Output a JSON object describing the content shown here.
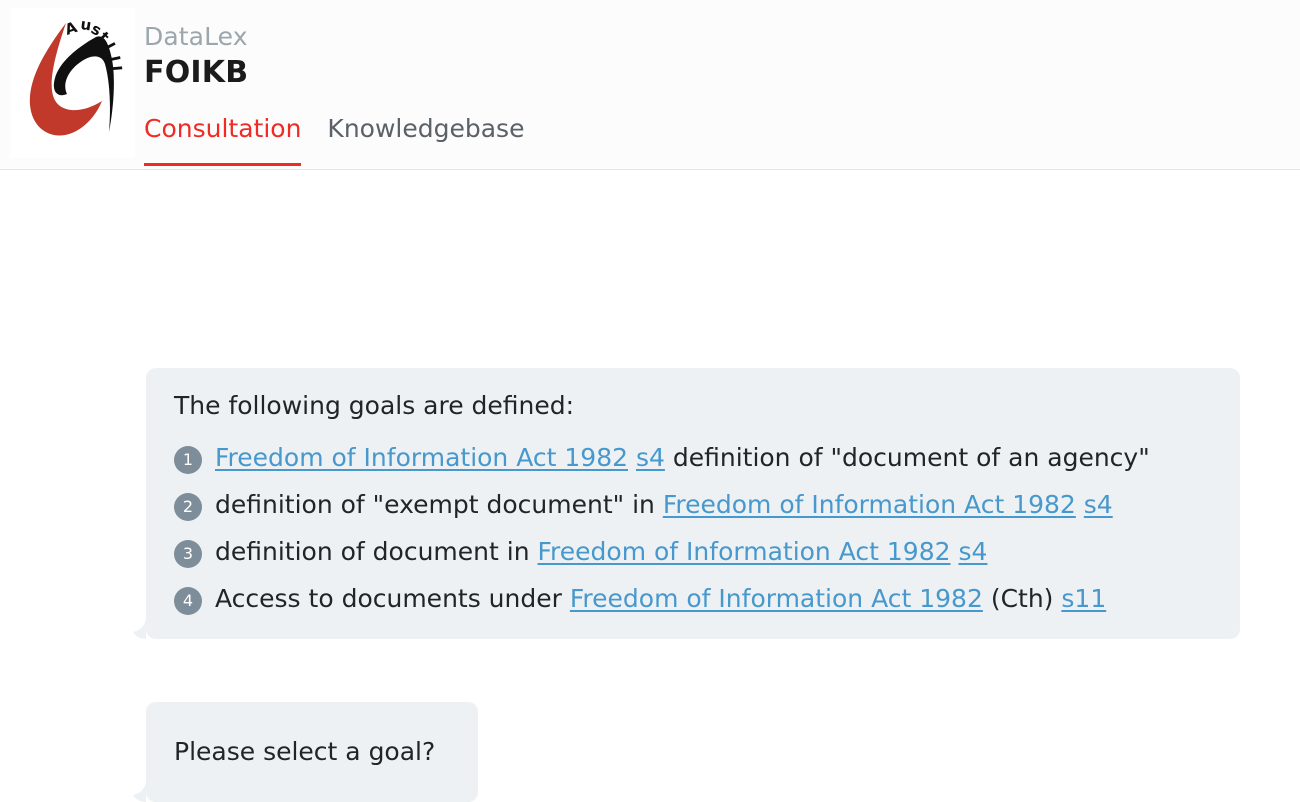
{
  "header": {
    "logo_alt": "austlii-logo",
    "brand_sub": "DataLex",
    "brand_title": "FOIKB",
    "tabs": [
      {
        "label": "Consultation",
        "active": true
      },
      {
        "label": "Knowledgebase",
        "active": false
      }
    ],
    "accent_color": "#ee2b24",
    "brand_sub_color": "#9ba7ad"
  },
  "conversation": {
    "bubble_color": "#edf1f3",
    "link_color": "#4798cc",
    "badge_color": "#7d8d99",
    "goals_bubble": {
      "lead_text": "The following goals are defined:",
      "goals": [
        {
          "number": "1",
          "parts": [
            {
              "type": "link",
              "text": "Freedom of Information Act 1982"
            },
            {
              "type": "text",
              "text": " "
            },
            {
              "type": "link",
              "text": "s4"
            },
            {
              "type": "text",
              "text": " definition of \"document of an agency\""
            }
          ]
        },
        {
          "number": "2",
          "parts": [
            {
              "type": "text",
              "text": "definition of \"exempt document\" in "
            },
            {
              "type": "link",
              "text": "Freedom of Information Act 1982"
            },
            {
              "type": "text",
              "text": " "
            },
            {
              "type": "link",
              "text": "s4"
            }
          ]
        },
        {
          "number": "3",
          "parts": [
            {
              "type": "text",
              "text": "definition of document in "
            },
            {
              "type": "link",
              "text": "Freedom of Information Act 1982"
            },
            {
              "type": "text",
              "text": " "
            },
            {
              "type": "link",
              "text": "s4"
            }
          ]
        },
        {
          "number": "4",
          "parts": [
            {
              "type": "text",
              "text": "Access to documents under "
            },
            {
              "type": "link",
              "text": "Freedom of Information Act 1982"
            },
            {
              "type": "text",
              "text": " (Cth) "
            },
            {
              "type": "link",
              "text": "s11"
            }
          ]
        }
      ]
    },
    "prompt_bubble": {
      "text": "Please select a goal?"
    }
  }
}
